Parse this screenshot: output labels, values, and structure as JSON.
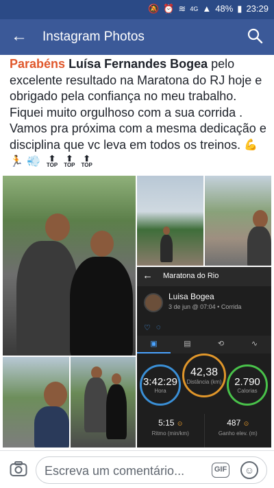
{
  "status_bar": {
    "battery": "48%",
    "time": "23:29",
    "network": "4G"
  },
  "app_bar": {
    "title": "Instagram Photos"
  },
  "caption": {
    "highlight": "Parabéns",
    "name": "Luísa Fernandes Bogea",
    "text": "pelo excelente resultado na Maratona do RJ hoje e obrigado pela confiança no meu trabalho. Fiquei muito orgulhoso com a sua corrida . Vamos pra próxima com a mesma dedicação e disciplina que vc leva em todos os treinos.",
    "emojis": [
      "💪",
      "🏃",
      "💨"
    ],
    "badges": [
      "TOP",
      "TOP",
      "TOP"
    ]
  },
  "app_screen": {
    "title": "Maratona do Rio",
    "user_name": "Luisa Bogea",
    "date": "3 de jun @ 07:04 • Corrida",
    "rings": [
      {
        "value": "3:42:29",
        "label": "Hora",
        "color": "#3a8fd6"
      },
      {
        "value": "42,38",
        "label": "Distância (km)",
        "color": "#e0962a"
      },
      {
        "value": "2.790",
        "label": "Calorias",
        "color": "#49c24a"
      }
    ],
    "stats": [
      {
        "value": "5:15",
        "label": "Ritmo (min/km)"
      },
      {
        "value": "487",
        "label": "Ganho elev. (m)"
      }
    ]
  },
  "composer": {
    "placeholder": "Escreva um comentário...",
    "gif_label": "GIF"
  }
}
